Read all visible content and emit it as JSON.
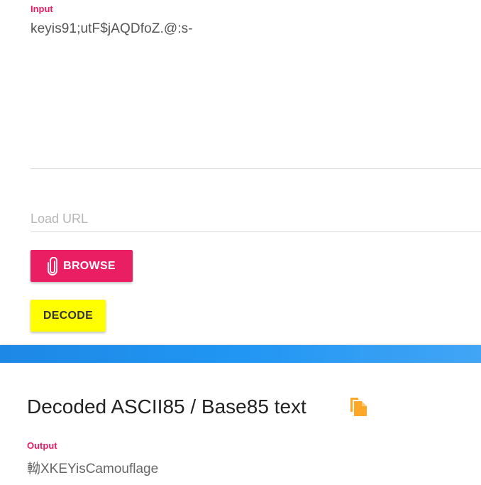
{
  "input": {
    "label": "Input",
    "value": "keyis91;utF$jAQDfoZ.@:s-"
  },
  "url": {
    "placeholder": "Load URL"
  },
  "buttons": {
    "browse_label": "BROWSE",
    "decode_label": "DECODE"
  },
  "output": {
    "title": "Decoded ASCII85 / Base85 text",
    "label": "Output",
    "value": "軪XKEYisCamouflage"
  },
  "icons": {
    "browse": "paperclip-icon",
    "copy": "copy-icon"
  },
  "colors": {
    "accent": "#e91e63",
    "decode_button": "#ffff00",
    "band": "#2196f3",
    "copy_icon": "#ffa726"
  }
}
